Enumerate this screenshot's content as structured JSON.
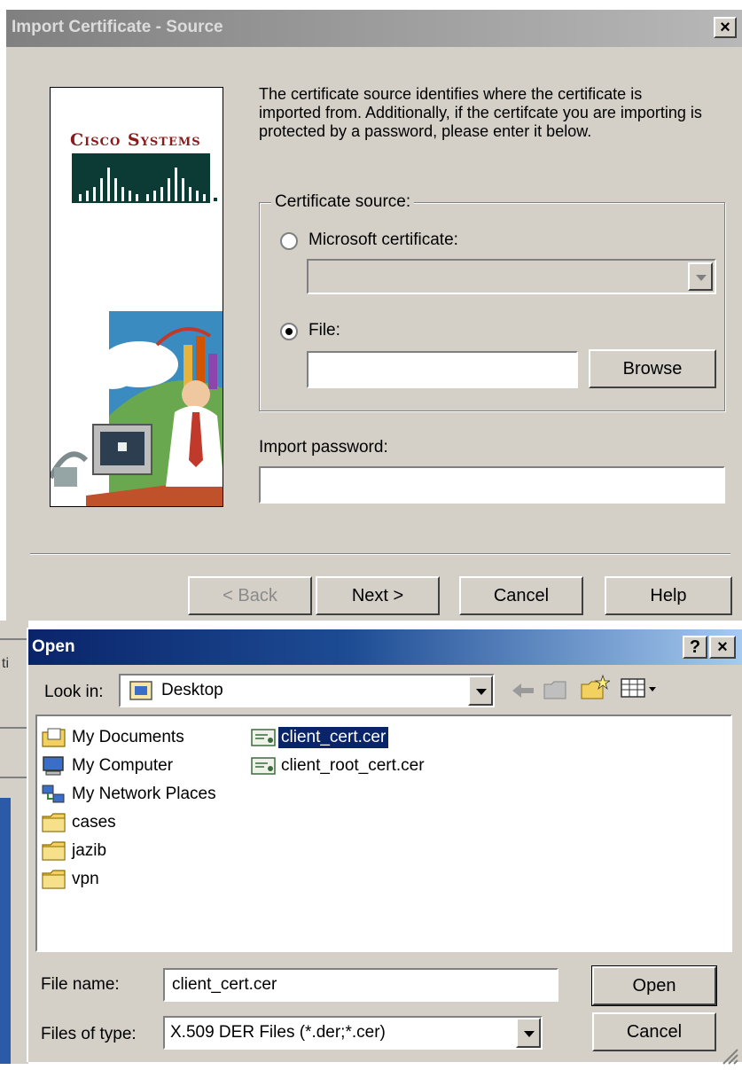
{
  "import_dialog": {
    "title": "Import Certificate - Source",
    "close_glyph": "×",
    "logo_text": "Cisco Systems",
    "description": "The certificate source identifies where the certificate is imported from.  Additionally, if the certifcate you are importing is protected by a password, please enter it below.",
    "source_group_label": "Certificate source:",
    "ms_cert_label": "Microsoft certificate:",
    "ms_cert_selected": false,
    "file_label": "File:",
    "file_selected": true,
    "file_value": "",
    "browse_label": "Browse",
    "password_label": "Import password:",
    "password_value": "",
    "back_label": "< Back",
    "next_label": "Next >",
    "cancel_label": "Cancel",
    "help_label": "Help"
  },
  "open_dialog": {
    "title": "Open",
    "help_glyph": "?",
    "close_glyph": "×",
    "look_in_label": "Look in:",
    "look_in_value": "Desktop",
    "items": [
      {
        "label": "My Documents",
        "icon": "my-documents-icon"
      },
      {
        "label": "My Computer",
        "icon": "my-computer-icon"
      },
      {
        "label": "My Network Places",
        "icon": "network-places-icon"
      },
      {
        "label": "cases",
        "icon": "folder-icon"
      },
      {
        "label": "jazib",
        "icon": "folder-icon"
      },
      {
        "label": "vpn",
        "icon": "folder-icon"
      }
    ],
    "files": [
      {
        "label": "client_cert.cer",
        "icon": "certificate-icon",
        "selected": true
      },
      {
        "label": "client_root_cert.cer",
        "icon": "certificate-icon",
        "selected": false
      }
    ],
    "file_name_label": "File name:",
    "file_name_value": "client_cert.cer",
    "files_of_type_label": "Files of type:",
    "files_of_type_value": "X.509 DER Files (*.der;*.cer)",
    "open_label": "Open",
    "cancel_label": "Cancel"
  },
  "background_fragment": "ti"
}
